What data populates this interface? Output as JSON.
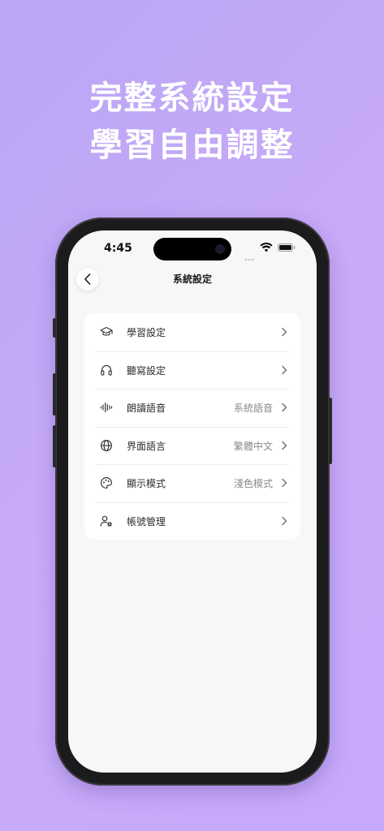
{
  "headline": {
    "line1": "完整系統設定",
    "line2": "學習自由調整"
  },
  "status_bar": {
    "time": "4:45"
  },
  "nav": {
    "title": "系統設定"
  },
  "settings": {
    "items": [
      {
        "icon": "graduation-cap-icon",
        "label": "學習設定",
        "value": ""
      },
      {
        "icon": "headphones-icon",
        "label": "聽寫設定",
        "value": ""
      },
      {
        "icon": "sound-wave-icon",
        "label": "朗讀語音",
        "value": "系統語音"
      },
      {
        "icon": "globe-icon",
        "label": "界面語言",
        "value": "繁體中文"
      },
      {
        "icon": "palette-icon",
        "label": "顯示模式",
        "value": "淺色模式"
      },
      {
        "icon": "user-gear-icon",
        "label": "帳號管理",
        "value": ""
      }
    ]
  },
  "colors": {
    "background": "#c3a8f7",
    "screen": "#f6f7f9",
    "card": "#ffffff",
    "text": "#2b2b2e",
    "secondary_text": "#8a8a90"
  }
}
